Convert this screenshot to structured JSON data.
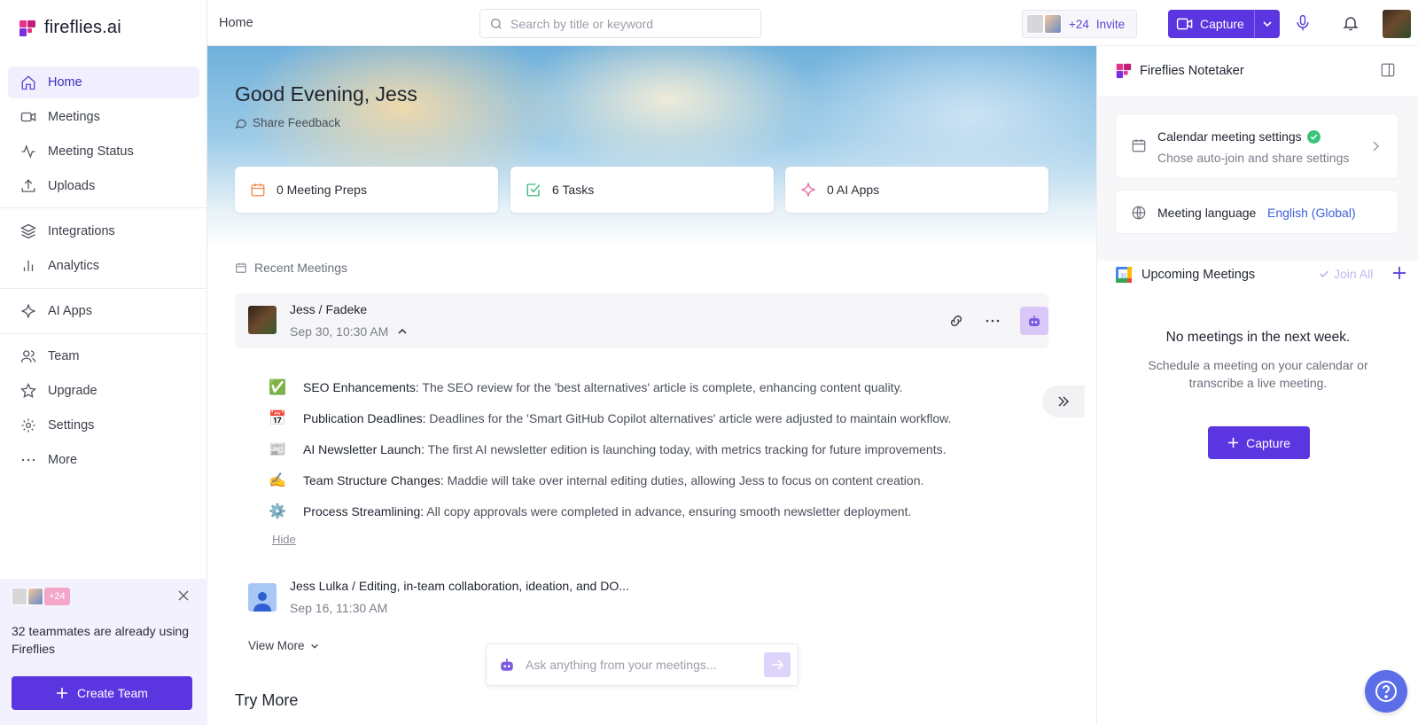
{
  "app": {
    "logo_text": "fireflies.ai"
  },
  "sidebar": {
    "items": [
      {
        "label": "Home",
        "icon": "home-icon",
        "active": true
      },
      {
        "label": "Meetings",
        "icon": "video-icon"
      },
      {
        "label": "Meeting Status",
        "icon": "activity-icon"
      },
      {
        "label": "Uploads",
        "icon": "upload-icon"
      },
      {
        "label": "Integrations",
        "icon": "layers-icon"
      },
      {
        "label": "Analytics",
        "icon": "bar-chart-icon"
      },
      {
        "label": "AI Apps",
        "icon": "sparkle-icon"
      },
      {
        "label": "Team",
        "icon": "users-icon"
      },
      {
        "label": "Upgrade",
        "icon": "star-icon"
      },
      {
        "label": "Settings",
        "icon": "gear-icon"
      },
      {
        "label": "More",
        "icon": "more-dots-icon"
      }
    ],
    "promo": {
      "count_badge": "+24",
      "text": "32 teammates are already using Fireflies",
      "button_label": "Create Team"
    }
  },
  "topbar": {
    "breadcrumb": "Home",
    "search_placeholder": "Search by title or keyword",
    "team_count": "+24",
    "invite_label": "Invite",
    "capture_label": "Capture"
  },
  "main": {
    "greeting": "Good Evening, Jess",
    "feedback_label": "Share Feedback",
    "stats": [
      {
        "label": "0 Meeting Preps",
        "icon": "calendar-icon",
        "color": "#f08a4b"
      },
      {
        "label": "6 Tasks",
        "icon": "check-square-icon",
        "color": "#3cb878"
      },
      {
        "label": "0 AI Apps",
        "icon": "sparkle-icon",
        "color": "#e86aa0"
      }
    ],
    "recent_heading": "Recent Meetings",
    "meetings": [
      {
        "title": "Jess / Fadeke",
        "date": "Sep 30, 10:30 AM",
        "summary": [
          {
            "emoji": "✅",
            "title": "SEO Enhancements:",
            "text": "The SEO review for the 'best alternatives' article is complete, enhancing content quality."
          },
          {
            "emoji": "📅",
            "title": "Publication Deadlines:",
            "text": "Deadlines for the 'Smart GitHub Copilot alternatives' article were adjusted to maintain workflow."
          },
          {
            "emoji": "📰",
            "title": "AI Newsletter Launch:",
            "text": "The first AI newsletter edition is launching today, with metrics tracking for future improvements."
          },
          {
            "emoji": "✍️",
            "title": "Team Structure Changes:",
            "text": "Maddie will take over internal editing duties, allowing Jess to focus on content creation."
          },
          {
            "emoji": "⚙️",
            "title": "Process Streamlining:",
            "text": "All copy approvals were completed in advance, ensuring smooth newsletter deployment."
          }
        ],
        "hide_label": "Hide"
      },
      {
        "title": "Jess Lulka / Editing, in-team collaboration, ideation, and DO...",
        "date": "Sep 16, 11:30 AM"
      }
    ],
    "view_more_label": "View More",
    "try_more_heading": "Try More",
    "ask_placeholder": "Ask anything from your meetings..."
  },
  "right_panel": {
    "title": "Fireflies Notetaker",
    "calendar_settings": {
      "title": "Calendar meeting settings",
      "subtitle": "Chose auto-join and share settings"
    },
    "language": {
      "label": "Meeting language",
      "value": "English (Global)"
    },
    "upcoming": {
      "title": "Upcoming Meetings",
      "join_all_label": "Join All",
      "empty_title": "No meetings in the next week.",
      "empty_subtitle": "Schedule a meeting on your calendar or transcribe a live meeting.",
      "capture_label": "Capture",
      "calendar_badge": "31"
    }
  },
  "colors": {
    "brand_purple": "#5a35e0",
    "active_bg": "#f1effd",
    "help_blue": "#5b6ee8",
    "success_green": "#3cc47c"
  }
}
